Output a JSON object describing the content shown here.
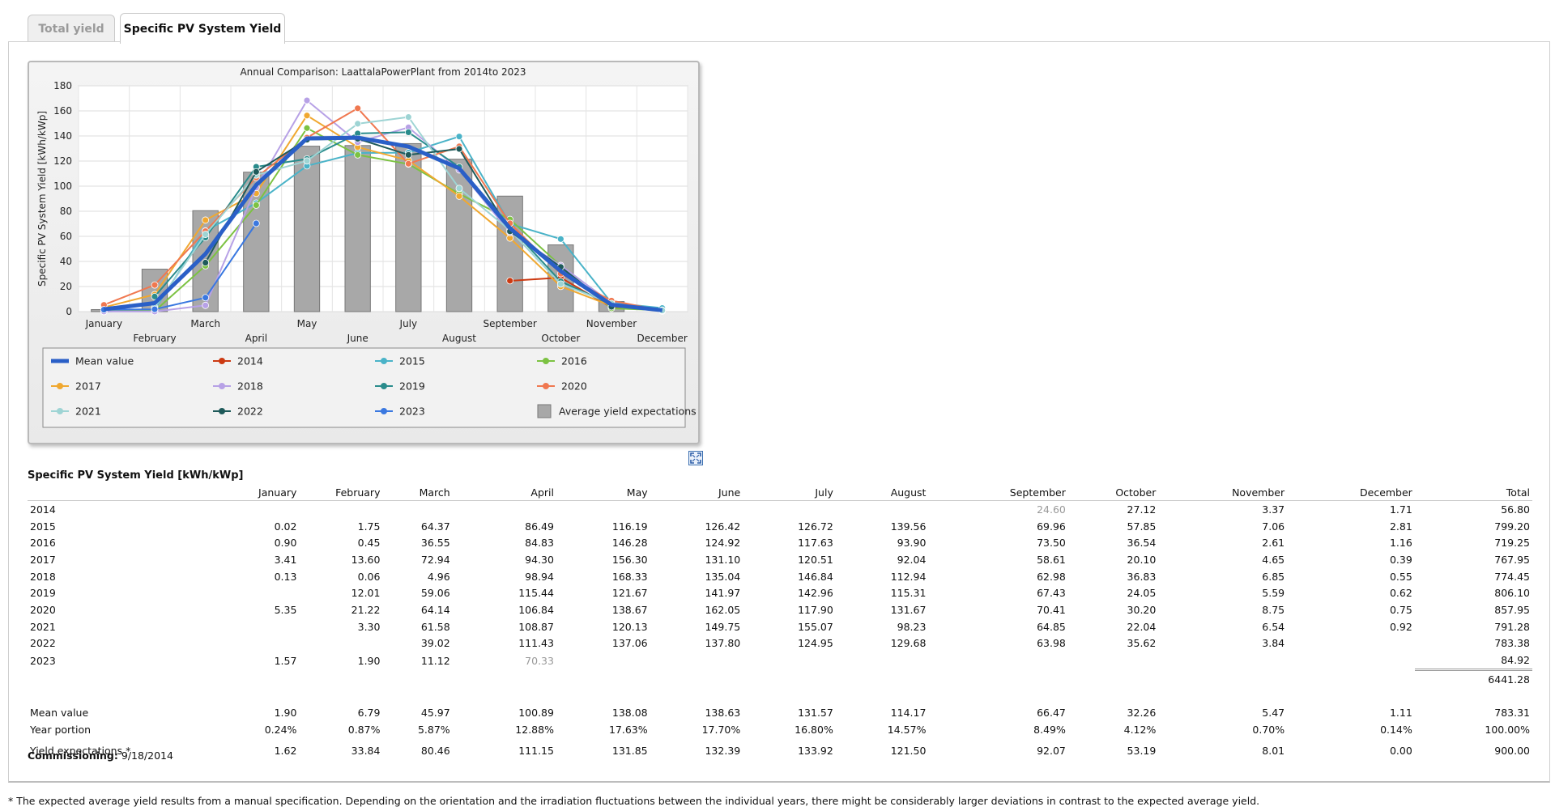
{
  "tabs": [
    {
      "label": "Total yield"
    },
    {
      "label": "Specific PV System Yield"
    }
  ],
  "chart_data": {
    "type": "bar+line",
    "title": "Annual Comparison: LaattalaPowerPlant from 2014to 2023",
    "xlabel": "",
    "ylabel": "Specific PV System Yield [kWh/kWp]",
    "ylim": [
      0,
      180
    ],
    "yticks": [
      0,
      20,
      40,
      60,
      80,
      100,
      120,
      140,
      160,
      180
    ],
    "grid": true,
    "legend_position": "bottom",
    "categories": [
      "January",
      "February",
      "March",
      "April",
      "May",
      "June",
      "July",
      "August",
      "September",
      "October",
      "November",
      "December"
    ],
    "bars": {
      "name": "Average yield expectations",
      "color": "#a8a8a8",
      "values": [
        1.62,
        33.84,
        80.46,
        111.15,
        131.85,
        132.39,
        133.92,
        121.5,
        92.07,
        53.19,
        8.01,
        0.0
      ]
    },
    "series": [
      {
        "name": "Mean value",
        "color": "#2a5fc7",
        "width": 5,
        "values": [
          1.9,
          6.79,
          45.97,
          100.89,
          138.08,
          138.63,
          131.57,
          114.17,
          66.47,
          32.26,
          5.47,
          1.11
        ]
      },
      {
        "name": "2014",
        "color": "#cc3a12",
        "width": 2,
        "values": [
          null,
          null,
          null,
          null,
          null,
          null,
          null,
          null,
          24.6,
          27.12,
          3.37,
          1.71
        ]
      },
      {
        "name": "2015",
        "color": "#4ab3c8",
        "width": 2,
        "values": [
          0.02,
          1.75,
          64.37,
          86.49,
          116.19,
          126.42,
          126.72,
          139.56,
          69.96,
          57.85,
          7.06,
          2.81
        ]
      },
      {
        "name": "2016",
        "color": "#7cc242",
        "width": 2,
        "values": [
          0.9,
          0.45,
          36.55,
          84.83,
          146.28,
          124.92,
          117.63,
          93.9,
          73.5,
          36.54,
          2.61,
          1.16
        ]
      },
      {
        "name": "2017",
        "color": "#f0a830",
        "width": 2,
        "values": [
          3.41,
          13.6,
          72.94,
          94.3,
          156.3,
          131.1,
          120.51,
          92.04,
          58.61,
          20.1,
          4.65,
          0.39
        ]
      },
      {
        "name": "2018",
        "color": "#b7a1e6",
        "width": 2,
        "values": [
          0.13,
          0.06,
          4.96,
          98.94,
          168.33,
          135.04,
          146.84,
          112.94,
          62.98,
          36.83,
          6.85,
          0.55
        ]
      },
      {
        "name": "2019",
        "color": "#2a8c8c",
        "width": 2,
        "values": [
          null,
          12.01,
          59.06,
          115.44,
          121.67,
          141.97,
          142.96,
          115.31,
          67.43,
          24.05,
          5.59,
          0.62
        ]
      },
      {
        "name": "2020",
        "color": "#f07850",
        "width": 2,
        "values": [
          5.35,
          21.22,
          64.14,
          106.84,
          138.67,
          162.05,
          117.9,
          131.67,
          70.41,
          30.2,
          8.75,
          0.75
        ]
      },
      {
        "name": "2021",
        "color": "#9ed4d4",
        "width": 2,
        "values": [
          null,
          3.3,
          61.58,
          108.87,
          120.13,
          149.75,
          155.07,
          98.23,
          64.85,
          22.04,
          6.54,
          0.92
        ]
      },
      {
        "name": "2022",
        "color": "#1f5a5a",
        "width": 2,
        "values": [
          null,
          null,
          39.02,
          111.43,
          137.06,
          137.8,
          124.95,
          129.68,
          63.98,
          35.62,
          3.84,
          null
        ]
      },
      {
        "name": "2023",
        "color": "#3a78e0",
        "width": 2,
        "values": [
          1.57,
          1.9,
          11.12,
          70.33,
          null,
          null,
          null,
          null,
          null,
          null,
          null,
          null
        ]
      }
    ]
  },
  "table": {
    "title": "Specific PV System Yield [kWh/kWp]",
    "columns": [
      "January",
      "February",
      "March",
      "April",
      "May",
      "June",
      "July",
      "August",
      "September",
      "October",
      "November",
      "December",
      "Total"
    ],
    "rows": [
      {
        "label": "2014",
        "cells": [
          "",
          "",
          "",
          "",
          "",
          "",
          "",
          "",
          "24.60",
          "27.12",
          "3.37",
          "1.71",
          "56.80"
        ],
        "grey": [
          8
        ]
      },
      {
        "label": "2015",
        "cells": [
          "0.02",
          "1.75",
          "64.37",
          "86.49",
          "116.19",
          "126.42",
          "126.72",
          "139.56",
          "69.96",
          "57.85",
          "7.06",
          "2.81",
          "799.20"
        ]
      },
      {
        "label": "2016",
        "cells": [
          "0.90",
          "0.45",
          "36.55",
          "84.83",
          "146.28",
          "124.92",
          "117.63",
          "93.90",
          "73.50",
          "36.54",
          "2.61",
          "1.16",
          "719.25"
        ]
      },
      {
        "label": "2017",
        "cells": [
          "3.41",
          "13.60",
          "72.94",
          "94.30",
          "156.30",
          "131.10",
          "120.51",
          "92.04",
          "58.61",
          "20.10",
          "4.65",
          "0.39",
          "767.95"
        ]
      },
      {
        "label": "2018",
        "cells": [
          "0.13",
          "0.06",
          "4.96",
          "98.94",
          "168.33",
          "135.04",
          "146.84",
          "112.94",
          "62.98",
          "36.83",
          "6.85",
          "0.55",
          "774.45"
        ]
      },
      {
        "label": "2019",
        "cells": [
          "",
          "12.01",
          "59.06",
          "115.44",
          "121.67",
          "141.97",
          "142.96",
          "115.31",
          "67.43",
          "24.05",
          "5.59",
          "0.62",
          "806.10"
        ]
      },
      {
        "label": "2020",
        "cells": [
          "5.35",
          "21.22",
          "64.14",
          "106.84",
          "138.67",
          "162.05",
          "117.90",
          "131.67",
          "70.41",
          "30.20",
          "8.75",
          "0.75",
          "857.95"
        ]
      },
      {
        "label": "2021",
        "cells": [
          "",
          "3.30",
          "61.58",
          "108.87",
          "120.13",
          "149.75",
          "155.07",
          "98.23",
          "64.85",
          "22.04",
          "6.54",
          "0.92",
          "791.28"
        ]
      },
      {
        "label": "2022",
        "cells": [
          "",
          "",
          "39.02",
          "111.43",
          "137.06",
          "137.80",
          "124.95",
          "129.68",
          "63.98",
          "35.62",
          "3.84",
          "",
          "783.38"
        ]
      },
      {
        "label": "2023",
        "cells": [
          "1.57",
          "1.90",
          "11.12",
          "70.33",
          "",
          "",
          "",
          "",
          "",
          "",
          "",
          "",
          "84.92"
        ],
        "grey": [
          3
        ]
      }
    ],
    "grand_total": "6441.28",
    "mean": {
      "label": "Mean value",
      "cells": [
        "1.90",
        "6.79",
        "45.97",
        "100.89",
        "138.08",
        "138.63",
        "131.57",
        "114.17",
        "66.47",
        "32.26",
        "5.47",
        "1.11",
        "783.31"
      ]
    },
    "portion": {
      "label": "Year portion",
      "cells": [
        "0.24%",
        "0.87%",
        "5.87%",
        "12.88%",
        "17.63%",
        "17.70%",
        "16.80%",
        "14.57%",
        "8.49%",
        "4.12%",
        "0.70%",
        "0.14%",
        "100.00%"
      ]
    },
    "expect": {
      "label": "Yield expectations *",
      "cells": [
        "1.62",
        "33.84",
        "80.46",
        "111.15",
        "131.85",
        "132.39",
        "133.92",
        "121.50",
        "92.07",
        "53.19",
        "8.01",
        "0.00",
        "900.00"
      ]
    }
  },
  "commissioning": {
    "label": "Commissioning:",
    "value": "9/18/2014"
  },
  "footnote": "* The expected average yield results from a manual specification. Depending on the orientation and the irradiation fluctuations between the individual years, there might be considerably larger deviations in contrast to the expected average yield.",
  "icons": {
    "expand": "expand-icon"
  }
}
